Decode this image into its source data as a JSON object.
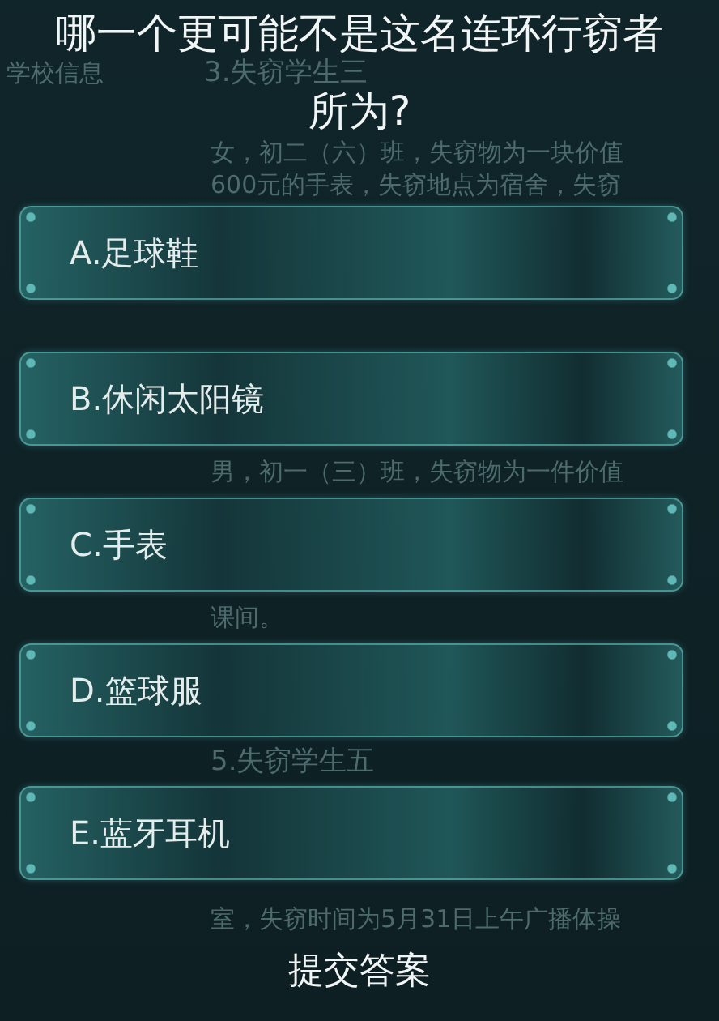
{
  "question": {
    "lines": [
      "哪一个更可能不是这名连环行窃者",
      "所为?"
    ],
    "background_row": {
      "sidebar": "学校信息",
      "heading": "3.失窃学生三"
    },
    "background_text_below": [
      {
        "kind": "line",
        "text": "女，初二（六）班，失窃物为一块价值"
      },
      {
        "kind": "line",
        "text": "600元的手表，失窃地点为宿舍，失窃"
      }
    ]
  },
  "options": [
    {
      "label": "A.足球鞋"
    },
    {
      "label": "B.休闲太阳镜",
      "background_text_below": [
        {
          "kind": "line",
          "text": "男，初一（三）班，失窃物为一件价值"
        }
      ]
    },
    {
      "label": "C.手表",
      "background_text_below": [
        {
          "kind": "line",
          "text": "课间。"
        }
      ]
    },
    {
      "label": "D.篮球服",
      "background_text_below": [
        {
          "kind": "heading",
          "text": "5.失窃学生五"
        }
      ]
    },
    {
      "label": "E.蓝牙耳机",
      "background_text_below": [
        {
          "kind": "line",
          "text": "室，失窃时间为5月31日上午广播体操"
        }
      ]
    }
  ],
  "submit_button": "提交答案"
}
